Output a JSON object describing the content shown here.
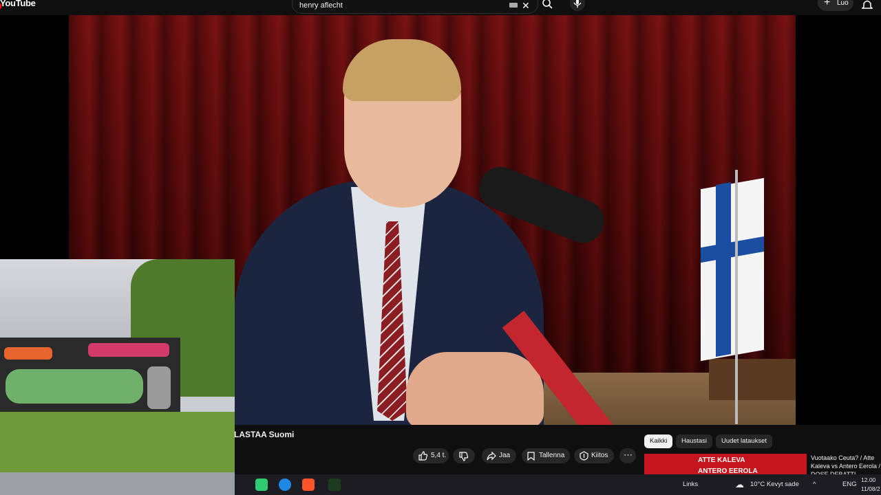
{
  "header": {
    "logo_text": "YouTube",
    "search_value": "henry aflecht",
    "create_label": "Luo"
  },
  "video": {
    "title": "LASTAA Suomi"
  },
  "actions": {
    "like_count": "5,4 t.",
    "share_label": "Jaa",
    "save_label": "Tallenna",
    "thanks_label": "Kiitos"
  },
  "filters": [
    "Kaikki",
    "Haustasi",
    "Uudet lataukset"
  ],
  "recommendation": {
    "thumb_line1": "ATTE KALEVA",
    "thumb_line2": "ANTERO EEROLA",
    "title": "Vuotaako Ceuta? / Atte Kaleva vs Antero Eerola / DOSE DEBATTI"
  },
  "taskbar": {
    "links_label": "Links",
    "weather": "10°C  Kevyt sade",
    "lang": "ENG",
    "time": "12.00",
    "date": "11/08/2"
  },
  "colors": {
    "accent_red": "#ff0000",
    "background": "#0f0f0f"
  }
}
